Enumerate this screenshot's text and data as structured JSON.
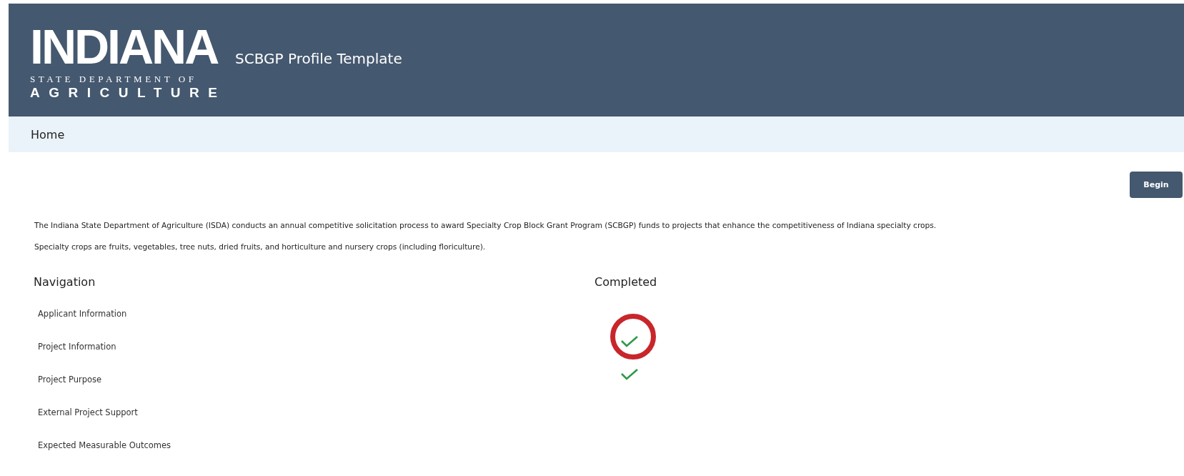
{
  "header": {
    "logo": {
      "main": "INDIANA",
      "line_1": "STATE DEPARTMENT OF",
      "line_2": "AGRICULTURE"
    },
    "title": "SCBGP Profile Template"
  },
  "breadcrumb": "Home",
  "begin_button": "Begin",
  "intro": [
    "The Indiana State Department of Agriculture (ISDA) conducts an annual competitive solicitation process to award Specialty Crop Block Grant Program (SCBGP) funds to projects that enhance the competitiveness of Indiana specialty crops.",
    "Specialty crops are fruits, vegetables, tree nuts, dried fruits, and horticulture and nursery crops (including floriculture)."
  ],
  "table": {
    "columns": [
      "Navigation",
      "Completed"
    ],
    "rows": [
      {
        "label": "Applicant Information",
        "completed": false,
        "circled": false
      },
      {
        "label": "Project Information",
        "completed": true,
        "circled": true
      },
      {
        "label": "Project Purpose",
        "completed": true,
        "circled": false
      },
      {
        "label": "External Project Support",
        "completed": false,
        "circled": false
      },
      {
        "label": "Expected Measurable Outcomes",
        "completed": false,
        "circled": false
      }
    ]
  }
}
